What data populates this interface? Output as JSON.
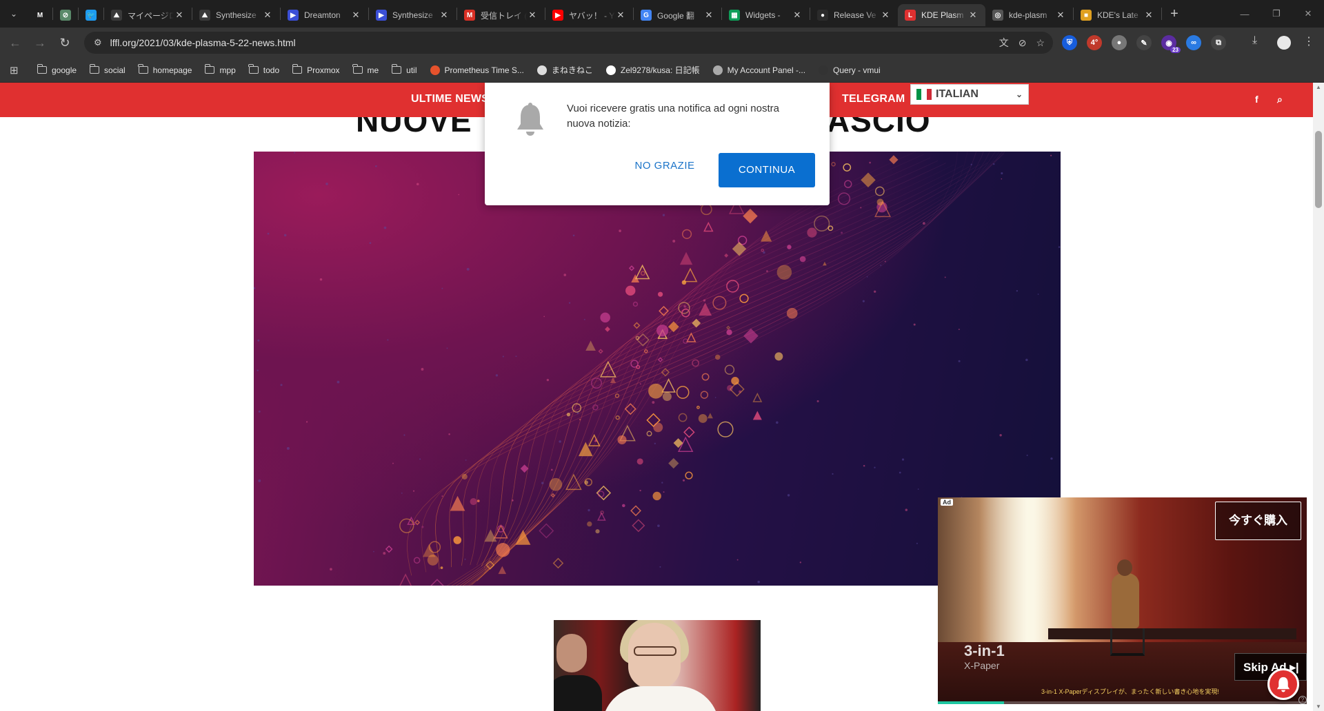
{
  "browser": {
    "tabs": [
      {
        "label": "",
        "icon": "m-app-icon",
        "color": "#1f1f1f",
        "glyph": "M"
      },
      {
        "label": "",
        "icon": "compass-icon",
        "color": "#5a8a6a",
        "glyph": "⊘"
      },
      {
        "label": "",
        "icon": "twitter-bird-icon",
        "color": "#1d9bf0",
        "glyph": "🐦"
      },
      {
        "label": "マイページロ",
        "icon": "mountain-logo-icon",
        "color": "#3a3a3a",
        "glyph": "⛰"
      },
      {
        "label": "Synthesize",
        "icon": "mountain-logo-icon",
        "color": "#3a3a3a",
        "glyph": "⛰"
      },
      {
        "label": "Dreamton",
        "icon": "play-triangle-icon",
        "color": "#3b4fd6",
        "glyph": "▶"
      },
      {
        "label": "Synthesize",
        "icon": "play-triangle-icon",
        "color": "#3b4fd6",
        "glyph": "▶"
      },
      {
        "label": "受信トレイ (",
        "icon": "gmail-icon",
        "color": "#d93025",
        "glyph": "M"
      },
      {
        "label": "ヤバッ！ - Y",
        "icon": "youtube-icon",
        "color": "#ff0000",
        "glyph": "▶"
      },
      {
        "label": "Google 翻",
        "icon": "google-translate-icon",
        "color": "#4285f4",
        "glyph": "G"
      },
      {
        "label": "Widgets -",
        "icon": "widgets-icon",
        "color": "#0f9d58",
        "glyph": "▦"
      },
      {
        "label": "Release Ve",
        "icon": "github-icon",
        "color": "#2b2b2b",
        "glyph": "●"
      },
      {
        "label": "KDE Plasm",
        "icon": "lffl-icon",
        "color": "#e03030",
        "glyph": "L",
        "active": true
      },
      {
        "label": "kde-plasm",
        "icon": "globe-icon",
        "color": "#555",
        "glyph": "◎"
      },
      {
        "label": "KDE's Late",
        "icon": "kde-news-icon",
        "color": "#e0a020",
        "glyph": "■"
      }
    ],
    "url": "lffl.org/2021/03/kde-plasma-5-22-news.html",
    "bookmarks": [
      {
        "label": "google",
        "type": "folder"
      },
      {
        "label": "social",
        "type": "folder"
      },
      {
        "label": "homepage",
        "type": "folder"
      },
      {
        "label": "mpp",
        "type": "folder"
      },
      {
        "label": "todo",
        "type": "folder"
      },
      {
        "label": "Proxmox",
        "type": "folder"
      },
      {
        "label": "me",
        "type": "folder"
      },
      {
        "label": "util",
        "type": "folder"
      },
      {
        "label": "Prometheus Time S...",
        "type": "site",
        "color": "#e6522c"
      },
      {
        "label": "まねきねこ",
        "type": "site",
        "color": "#ddd"
      },
      {
        "label": "Zel9278/kusa: 日記帳",
        "type": "site",
        "color": "#fff"
      },
      {
        "label": "My Account Panel -...",
        "type": "site",
        "color": "#aaa"
      },
      {
        "label": "Query - vmui",
        "type": "site",
        "color": "#333"
      }
    ],
    "extensions": [
      {
        "name": "bitwarden-icon",
        "color": "#175ddc",
        "glyph": "⛨"
      },
      {
        "name": "4-degree-icon",
        "color": "#c0392b",
        "glyph": "4°"
      },
      {
        "name": "gray-circle-icon",
        "color": "#777",
        "glyph": "●"
      },
      {
        "name": "eyedropper-icon",
        "color": "#444",
        "glyph": "✎"
      },
      {
        "name": "purple-ext-icon",
        "color": "#5b2ca0",
        "glyph": "◉",
        "badge": "23"
      },
      {
        "name": "mask-icon",
        "color": "#2a7ae2",
        "glyph": "∞"
      },
      {
        "name": "puzzle-icon",
        "color": "#444",
        "glyph": "⧉"
      }
    ]
  },
  "site": {
    "nav": {
      "latest_news": "ULTIME NEWS",
      "telegram": "TELEGRAM",
      "language": "ITALIAN",
      "facebook": "f",
      "search": "⌕"
    },
    "headline_fragment": "NUOVE",
    "headline_fragment_right": "ILASCIO"
  },
  "notification": {
    "message": "Vuoi ricevere gratis una notifica ad ogni nostra nuova notizia:",
    "decline": "NO GRAZIE",
    "accept": "CONTINUA"
  },
  "ad": {
    "label": "Ad",
    "buy_label": "今すぐ購入",
    "brand": "3-in-1",
    "brand_sub": "X-Paper",
    "caption": "3-in-1 X-Paperディスプレイが、まったく新しい書き心地を実現!",
    "skip_label": "Skip Ad ▸|",
    "progress_fraction": 0.18
  }
}
